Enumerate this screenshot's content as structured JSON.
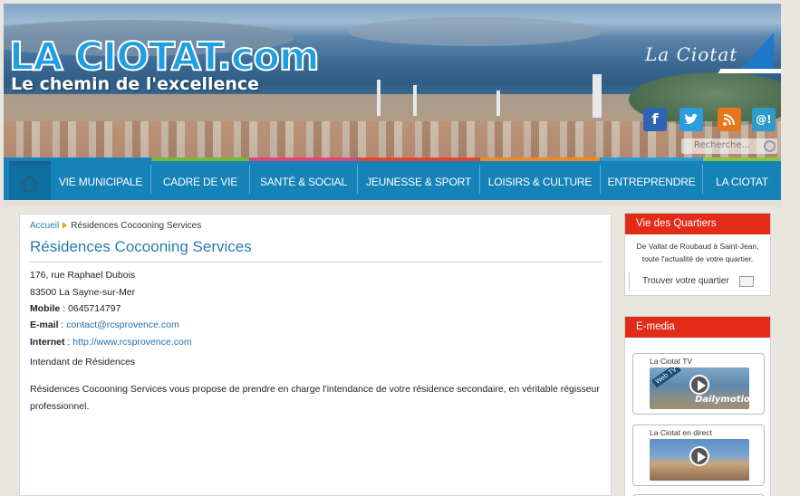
{
  "header": {
    "logo_main": "LA CIOTAT.com",
    "logo_tagline": "Le chemin de l'excellence",
    "brand_script": "La Ciotat",
    "search_placeholder": "Recherche..."
  },
  "social": {
    "facebook": "f",
    "twitter": "t",
    "rss": "ʃ",
    "mail": "@!"
  },
  "nav": {
    "items": [
      {
        "label": "VIE MUNICIPALE",
        "color": "#1582b8"
      },
      {
        "label": "CADRE DE VIE",
        "color": "#76b83a"
      },
      {
        "label": "SANTÉ & SOCIAL",
        "color": "#e0457c"
      },
      {
        "label": "JEUNESSE & SPORT",
        "color": "#e3462c"
      },
      {
        "label": "LOISIRS & CULTURE",
        "color": "#f08a1c"
      },
      {
        "label": "ENTREPRENDRE",
        "color": "#2f9bd1"
      },
      {
        "label": "LA CIOTAT",
        "color": "#8dc63f"
      }
    ]
  },
  "breadcrumb": {
    "home": "Accueil",
    "current": "Résidences Cocooning Services"
  },
  "page": {
    "title": "Résidences Cocooning Services",
    "address1": "176, rue Raphael Dubois",
    "address2": "83500 La Sayne-sur-Mer",
    "mobile_label": "Mobile",
    "mobile_value": "0645714797",
    "email_label": "E-mail",
    "email_value": "contact@rcsprovence.com",
    "internet_label": "Internet",
    "internet_value": "http://www.rcsprovence.com",
    "category": "Intendant de Résidences",
    "description": "Résidences Cocooning Services vous propose de prendre en charge l'intendance de votre résidence secondaire, en véritable régisseur professionnel."
  },
  "sidebar": {
    "quartiers": {
      "heading": "Vie des Quartiers",
      "text": "De Vallat de Roubaud à Saint-Jean, toute l'actualité de votre quartier.",
      "link": "Trouver votre quartier"
    },
    "emedia": {
      "heading": "E-media",
      "items": [
        {
          "label": "La Ciotat TV",
          "brand": "Dailymotion",
          "badge": "Web TV"
        },
        {
          "label": "La Ciotat en direct"
        }
      ]
    }
  }
}
